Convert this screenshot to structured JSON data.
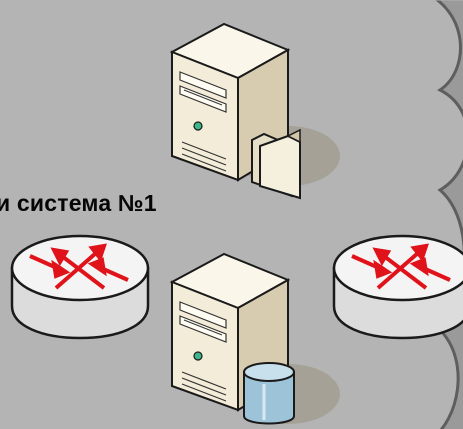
{
  "system_label": "и система №1",
  "nodes": [
    {
      "id": "file-server",
      "icon": "server-with-folder-icon"
    },
    {
      "id": "router-left",
      "icon": "router-icon"
    },
    {
      "id": "database-server",
      "icon": "server-with-database-icon"
    },
    {
      "id": "router-right",
      "icon": "router-icon"
    }
  ],
  "colors": {
    "background": "#9a9a9a",
    "cloud": "#b4b4b4",
    "cloud_outline": "#5e5e5e",
    "server_body": "#f2ecd8",
    "router_arrows": "#e0121a",
    "database": "#9cc3d8"
  }
}
